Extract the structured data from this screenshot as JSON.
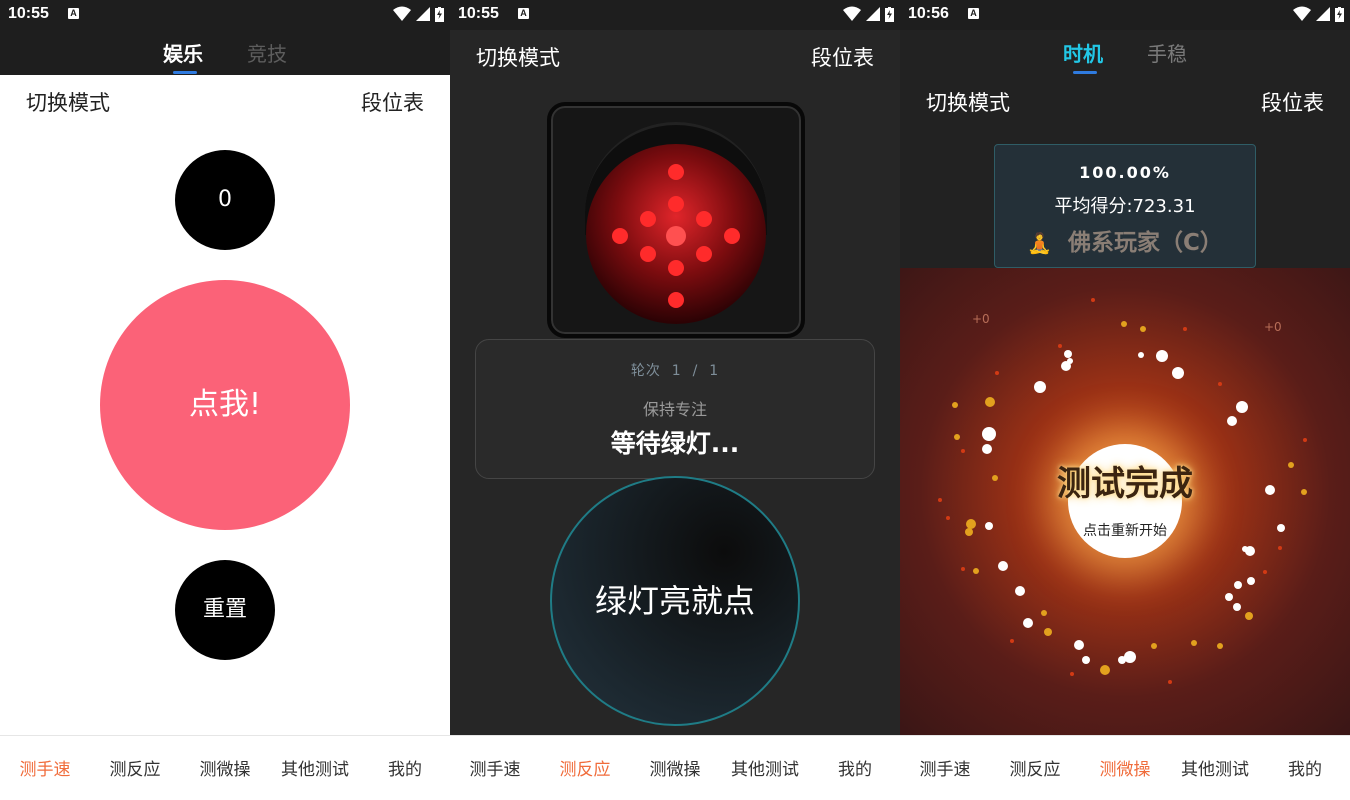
{
  "status_bars": [
    {
      "time": "10:55"
    },
    {
      "time": "10:55"
    },
    {
      "time": "10:56"
    }
  ],
  "status_icons": {
    "notification": "A",
    "wifi": "wifi-icon",
    "signal": "signal-icon",
    "battery": "battery-charging-icon"
  },
  "screen1": {
    "tabs": [
      {
        "label": "娱乐"
      },
      {
        "label": "竞技"
      }
    ],
    "switch_mode": "切换模式",
    "rank_table": "段位表",
    "counter": "0",
    "tap_button": "点我!",
    "reset_button": "重置"
  },
  "screen2": {
    "switch_mode": "切换模式",
    "rank_table": "段位表",
    "round_text": "轮次  1  /  1",
    "keep_focus": "保持专注",
    "waiting": "等待绿灯...",
    "action_button": "绿灯亮就点"
  },
  "screen3": {
    "tabs": [
      {
        "label": "时机"
      },
      {
        "label": "手稳"
      }
    ],
    "switch_mode": "切换模式",
    "rank_table": "段位表",
    "accuracy": "100.00%",
    "avg_score": "平均得分:723.31",
    "rank_emoji": "🧘",
    "rank_label": "佛系玩家（C）",
    "plus_left": "+0",
    "plus_right": "+0",
    "done_title": "测试完成",
    "restart_hint": "点击重新开始"
  },
  "bottom_nav": [
    "测手速",
    "测反应",
    "测微操",
    "其他测试",
    "我的"
  ],
  "colors": {
    "accent_orange": "#f06c3b",
    "tap_red": "#fb6278",
    "tab_blue": "#2f7be0",
    "cyan_tab": "#22c7e6"
  }
}
